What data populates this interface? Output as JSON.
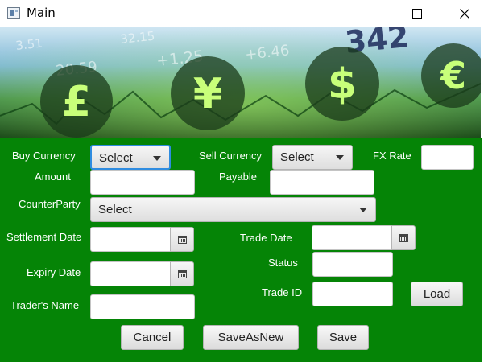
{
  "window": {
    "title": "Main",
    "icons": {
      "app": "window-app-icon",
      "minimize": "minimize-icon",
      "maximize": "maximize-icon",
      "close": "close-icon"
    }
  },
  "banner": {
    "numbers": [
      "20.59",
      "+1.25",
      "+6.46",
      "342",
      "3.51",
      "32.15"
    ],
    "symbols": [
      "£",
      "¥",
      "$",
      "€"
    ]
  },
  "form": {
    "buy_currency": {
      "label": "Buy Currency",
      "value": "Select"
    },
    "sell_currency": {
      "label": "Sell Currency",
      "value": "Select"
    },
    "fx_rate": {
      "label": "FX Rate",
      "value": ""
    },
    "amount": {
      "label": "Amount",
      "value": ""
    },
    "payable": {
      "label": "Payable",
      "value": ""
    },
    "counterparty": {
      "label": "CounterParty",
      "value": "Select"
    },
    "settlement_date": {
      "label": "Settlement Date",
      "value": ""
    },
    "trade_date": {
      "label": "Trade Date",
      "value": ""
    },
    "expiry_date": {
      "label": "Expiry Date",
      "value": ""
    },
    "status": {
      "label": "Status",
      "value": ""
    },
    "trade_id": {
      "label": "Trade ID",
      "value": ""
    },
    "traders_name": {
      "label": "Trader's Name",
      "value": ""
    }
  },
  "buttons": {
    "load": "Load",
    "cancel": "Cancel",
    "save_as_new": "SaveAsNew",
    "save": "Save"
  },
  "colors": {
    "form_background": "#058406",
    "focus_ring": "#2f8ce0"
  }
}
